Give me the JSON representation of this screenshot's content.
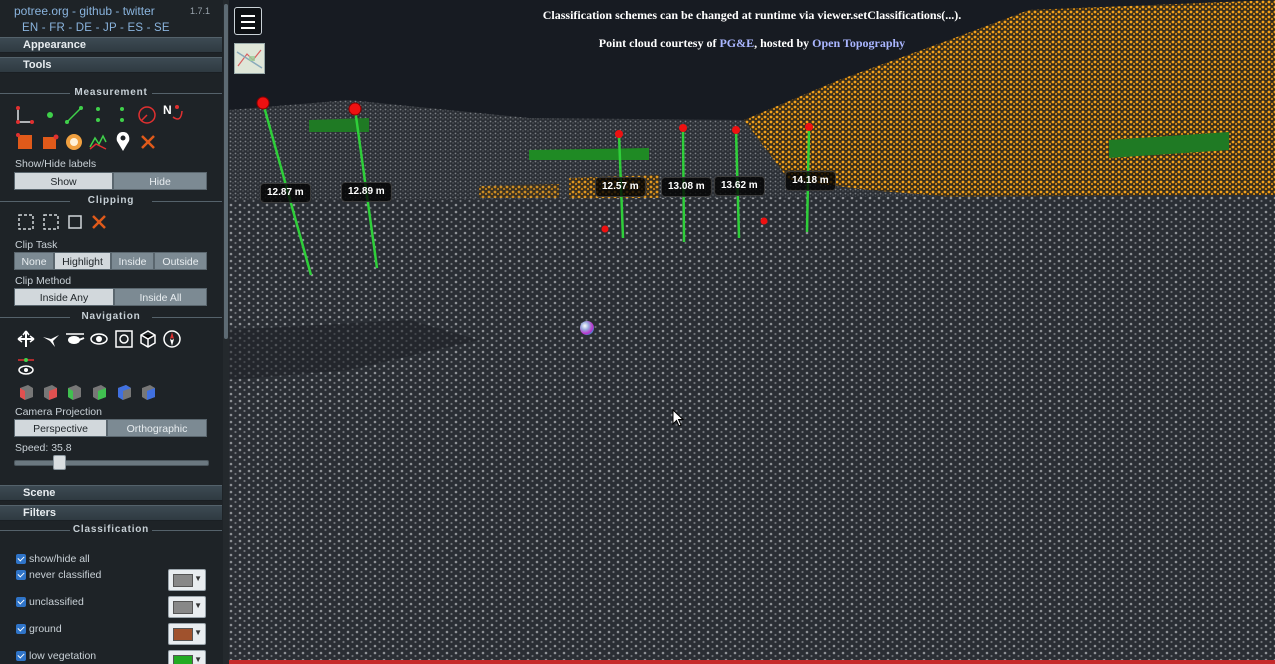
{
  "header": {
    "links": [
      "potree.org",
      "github",
      "twitter"
    ],
    "link_separator": " - ",
    "version": "1.7.1",
    "languages": [
      "EN",
      "FR",
      "DE",
      "JP",
      "ES",
      "SE"
    ],
    "language_separator": " - "
  },
  "accordions": {
    "appearance": "Appearance",
    "tools": "Tools",
    "scene": "Scene",
    "filters": "Filters"
  },
  "measurement": {
    "title": "Measurement",
    "labels_title": "Show/Hide labels",
    "show": "Show",
    "hide": "Hide",
    "north_label": "N",
    "icons": [
      "angle-icon",
      "point-icon",
      "distance-icon",
      "height-icon",
      "circle-icon",
      "azimuth-icon",
      "area-icon",
      "volume-box-icon",
      "volume-sphere-icon",
      "profile-icon",
      "annotation-icon",
      "remove-all-icon"
    ]
  },
  "clipping": {
    "title": "Clipping",
    "task_label": "Clip Task",
    "tasks": [
      "None",
      "Highlight",
      "Inside",
      "Outside"
    ],
    "active_task": "Highlight",
    "method_label": "Clip Method",
    "methods": [
      "Inside Any",
      "Inside All"
    ],
    "active_method": "Inside Any"
  },
  "navigation": {
    "title": "Navigation",
    "projection_label": "Camera Projection",
    "projections": [
      "Perspective",
      "Orthographic"
    ],
    "active_projection": "Perspective",
    "speed_label": "Speed: 35.8",
    "speed_fraction": 0.23
  },
  "classification": {
    "title": "Classification",
    "show_all": "show/hide all",
    "items": [
      {
        "label": "never classified",
        "color": "#888888",
        "checked": true
      },
      {
        "label": "unclassified",
        "color": "#888888",
        "checked": true
      },
      {
        "label": "ground",
        "color": "#a0522d",
        "checked": true
      },
      {
        "label": "low vegetation",
        "color": "#22aa22",
        "checked": true
      }
    ]
  },
  "viewer": {
    "banner_line1": "Classification schemes can be changed at runtime via viewer.setClassifications(...).",
    "banner_prefix": "Point cloud courtesy of ",
    "banner_link1": "PG&E",
    "banner_middle": ", hosted by ",
    "banner_link2": "Open Topography",
    "measurements": [
      "12.87 m",
      "12.89 m",
      "12.57 m",
      "13.08 m",
      "13.62 m",
      "14.18 m"
    ],
    "colors": {
      "ground_points": "#9a9a9a",
      "building_points": "#f0a020",
      "vegetation_points": "#22aa22",
      "measure_line": "#2fcf3a",
      "measure_marker": "#ee1111"
    }
  }
}
